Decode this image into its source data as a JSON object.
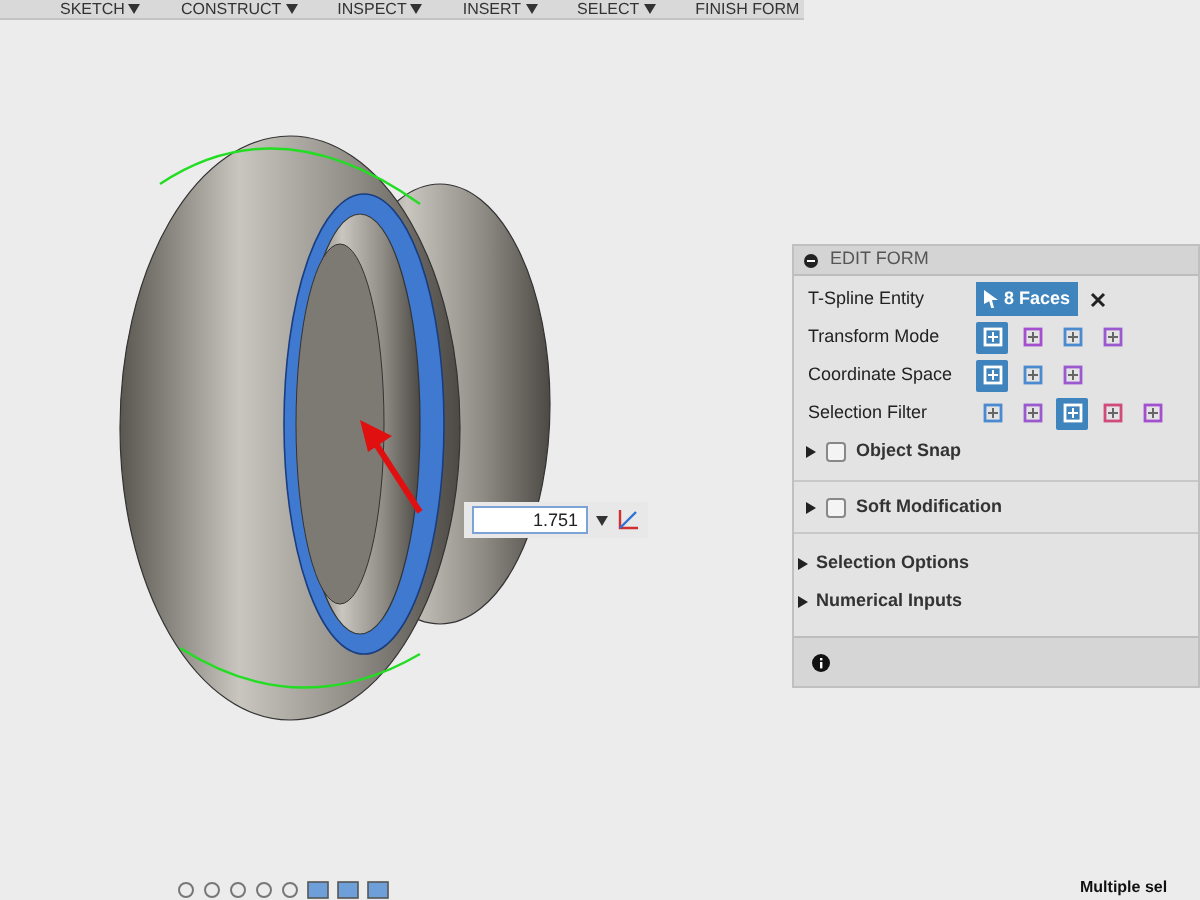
{
  "toolbar": [
    {
      "label": "SKETCH",
      "dropdown": true
    },
    {
      "label": "CONSTRUCT",
      "dropdown": true
    },
    {
      "label": "INSPECT",
      "dropdown": true
    },
    {
      "label": "INSERT",
      "dropdown": true
    },
    {
      "label": "SELECT",
      "dropdown": true
    },
    {
      "label": "FINISH FORM",
      "dropdown": false
    }
  ],
  "dimension_input": {
    "value": "1.751"
  },
  "panel": {
    "title": "EDIT FORM",
    "rows": [
      {
        "kind": "entity",
        "label": "T-Spline Entity",
        "value": "8 Faces"
      },
      {
        "kind": "icons",
        "label": "Transform Mode",
        "icons": [
          {
            "selected": true
          },
          {
            "selected": false
          },
          {
            "selected": false
          },
          {
            "selected": false
          }
        ]
      },
      {
        "kind": "icons",
        "label": "Coordinate Space",
        "icons": [
          {
            "selected": true
          },
          {
            "selected": false
          },
          {
            "selected": false
          }
        ]
      },
      {
        "kind": "icons",
        "label": "Selection Filter",
        "icons": [
          {
            "selected": false
          },
          {
            "selected": false
          },
          {
            "selected": true
          },
          {
            "selected": false
          },
          {
            "selected": false
          }
        ]
      }
    ],
    "options": [
      {
        "label": "Object Snap",
        "checked": false
      },
      {
        "label": "Soft Modification",
        "checked": false
      }
    ],
    "sections": [
      "Selection Options",
      "Numerical Inputs"
    ]
  },
  "status_text": "Multiple sel"
}
